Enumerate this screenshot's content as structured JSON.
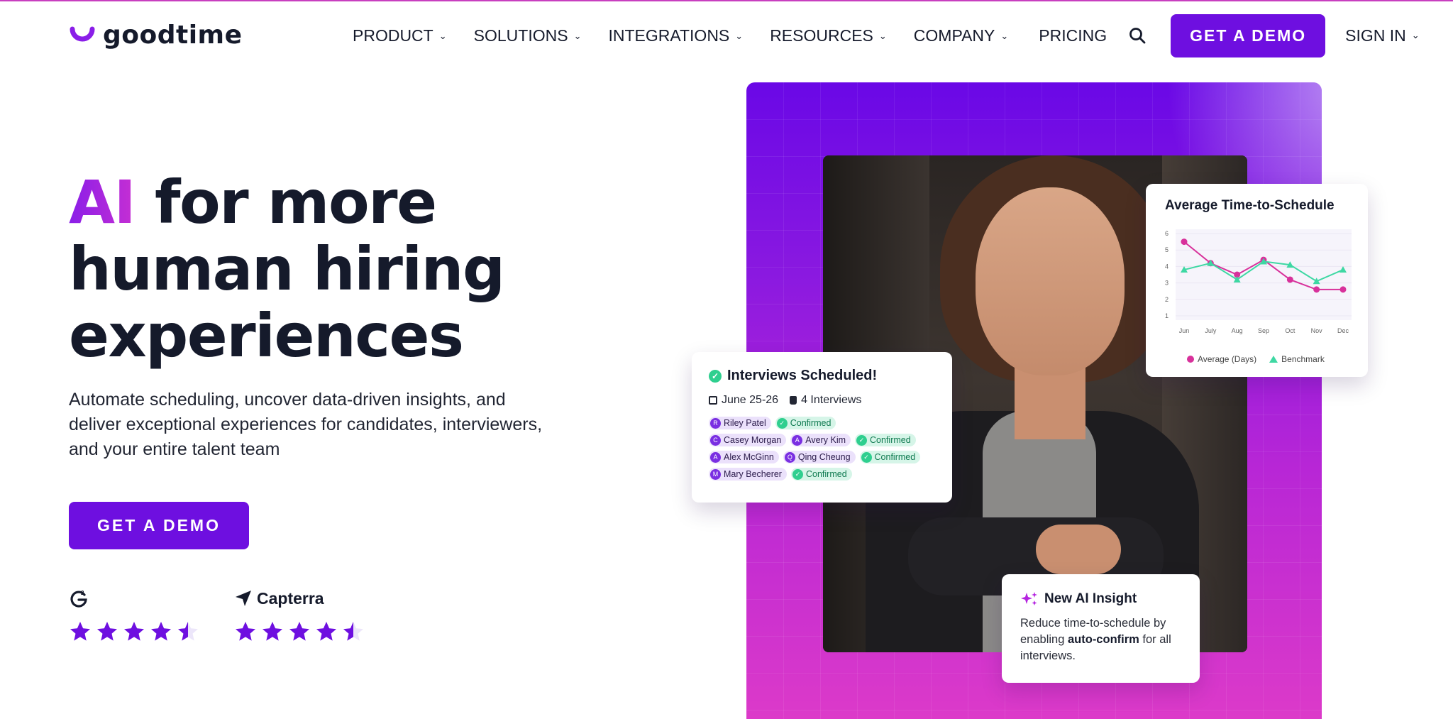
{
  "brand": {
    "name": "goodtime",
    "accent": "#6e0fe0",
    "logo_color": "#8a1ee8"
  },
  "nav": {
    "items": [
      {
        "label": "PRODUCT",
        "has_menu": true
      },
      {
        "label": "SOLUTIONS",
        "has_menu": true
      },
      {
        "label": "INTEGRATIONS",
        "has_menu": true
      },
      {
        "label": "RESOURCES",
        "has_menu": true
      },
      {
        "label": "COMPANY",
        "has_menu": true
      }
    ],
    "pricing": "PRICING",
    "search_icon": "search-icon",
    "cta": "GET A DEMO",
    "signin": "SIGN IN"
  },
  "hero": {
    "title_ai": "AI",
    "title_line1_rest": " for more",
    "title_line2": "human hiring",
    "title_line3": "experiences",
    "subtitle": "Automate scheduling, uncover data-driven insights, and deliver exceptional experiences for candidates, interviewers, and your entire talent team",
    "cta": "GET A DEMO"
  },
  "ratings": {
    "g2": {
      "brand": "G2",
      "stars": 4.5
    },
    "capterra": {
      "brand": "Capterra",
      "stars": 4.5
    },
    "star_color": "#6e0fe0"
  },
  "interviews_card": {
    "title": "Interviews Scheduled!",
    "date": "June 25-26",
    "count": "4 Interviews",
    "rows": [
      [
        {
          "initial": "R",
          "text": "Riley Patel",
          "kind": "person"
        },
        {
          "text": "Confirmed",
          "kind": "ok"
        }
      ],
      [
        {
          "initial": "C",
          "text": "Casey Morgan",
          "kind": "person"
        },
        {
          "initial": "A",
          "text": "Avery Kim",
          "kind": "person"
        },
        {
          "text": "Confirmed",
          "kind": "ok"
        }
      ],
      [
        {
          "initial": "A",
          "text": "Alex McGinn",
          "kind": "person"
        },
        {
          "initial": "Q",
          "text": "Qing Cheung",
          "kind": "person"
        },
        {
          "text": "Confirmed",
          "kind": "ok"
        }
      ],
      [
        {
          "initial": "M",
          "text": "Mary Becherer",
          "kind": "person"
        },
        {
          "text": "Confirmed",
          "kind": "ok"
        }
      ]
    ]
  },
  "chart_card": {
    "title": "Average Time-to-Schedule",
    "chart_data": {
      "type": "line",
      "title": "Average Time-to-Schedule",
      "categories": [
        "Jun",
        "July",
        "Aug",
        "Sep",
        "Oct",
        "Nov",
        "Dec"
      ],
      "ylim": [
        1,
        6
      ],
      "yticks": [
        1,
        2,
        3,
        4,
        5,
        6
      ],
      "series": [
        {
          "name": "Average (Days)",
          "marker": "circle",
          "color": "#d8319b",
          "values": [
            5.5,
            4.2,
            3.5,
            4.4,
            3.2,
            2.6,
            2.6
          ]
        },
        {
          "name": "Benchmark",
          "marker": "triangle",
          "color": "#3ed8a3",
          "values": [
            3.8,
            4.2,
            3.2,
            4.3,
            4.1,
            3.1,
            3.8
          ]
        }
      ],
      "legend": "bottom"
    }
  },
  "insight_card": {
    "title": "New AI Insight",
    "body_pre": "Reduce time-to-schedule by enabling ",
    "body_bold": "auto-confirm",
    "body_post": " for all interviews."
  }
}
